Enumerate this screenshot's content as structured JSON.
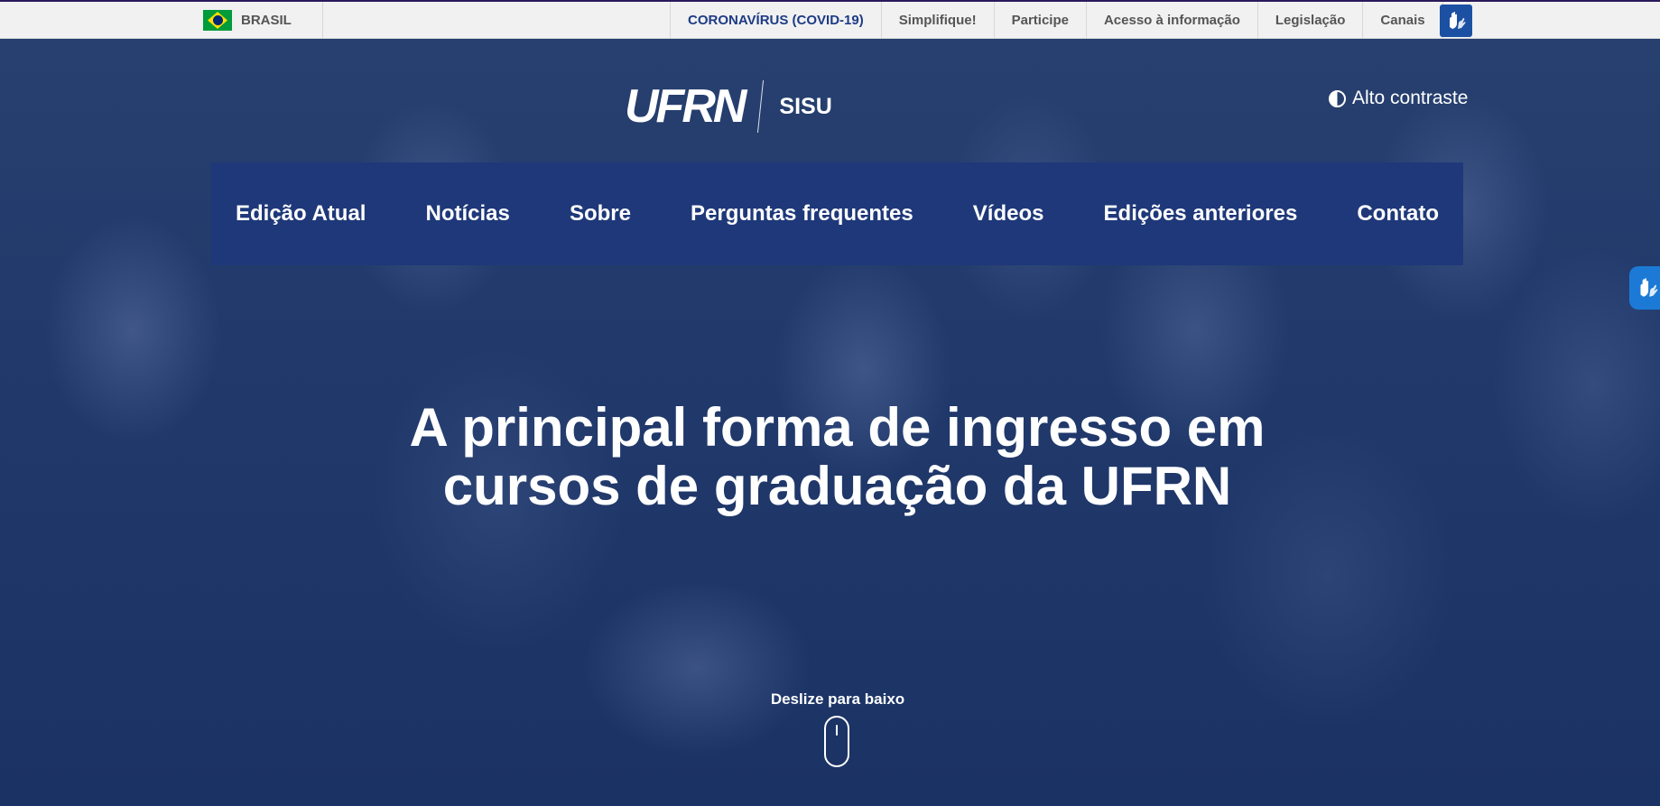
{
  "gov_bar": {
    "country_label": "BRASIL",
    "links": [
      {
        "label": "CORONAVÍRUS (COVID-19)",
        "name": "gov-link-coronavirus"
      },
      {
        "label": "Simplifique!",
        "name": "gov-link-simplifique"
      },
      {
        "label": "Participe",
        "name": "gov-link-participe"
      },
      {
        "label": "Acesso à informação",
        "name": "gov-link-acesso-informacao"
      },
      {
        "label": "Legislação",
        "name": "gov-link-legislacao"
      },
      {
        "label": "Canais",
        "name": "gov-link-canais"
      }
    ],
    "accessibility_icon": "vlibras-hands-icon"
  },
  "header": {
    "logo_text": "UFRN",
    "site_name": "SISU",
    "contrast_label": "Alto contraste",
    "contrast_icon": "contrast-icon"
  },
  "nav": {
    "items": [
      "Edição Atual",
      "Notícias",
      "Sobre",
      "Perguntas frequentes",
      "Vídeos",
      "Edições anteriores",
      "Contato"
    ]
  },
  "hero": {
    "headline_line1": "A principal forma de ingresso em",
    "headline_line2": "cursos de graduação da UFRN",
    "scroll_label": "Deslize para baixo",
    "scroll_icon": "mouse-icon"
  },
  "colors": {
    "gov_bar_bg": "#f1f1f1",
    "covid_link": "#1d3b85",
    "nav_bg": "#1e3879",
    "hero_overlay": "#1c3364",
    "vlibras_blue": "#1c7ad6"
  }
}
